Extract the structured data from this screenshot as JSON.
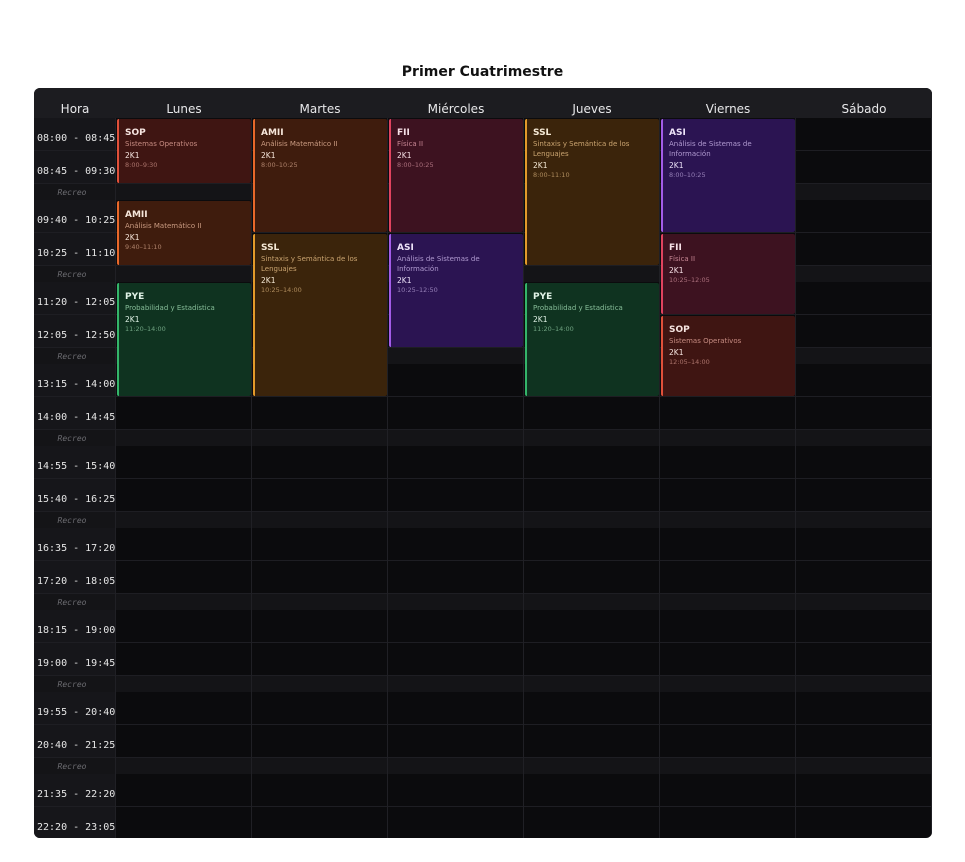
{
  "title": "Primer Cuatrimestre",
  "header": {
    "hora": "Hora",
    "days": [
      "Lunes",
      "Martes",
      "Miércoles",
      "Jueves",
      "Viernes",
      "Sábado"
    ]
  },
  "rows": [
    {
      "type": "slot",
      "label": "08:00 - 08:45"
    },
    {
      "type": "slot",
      "label": "08:45 - 09:30"
    },
    {
      "type": "recess",
      "label": "Recreo"
    },
    {
      "type": "slot",
      "label": "09:40 - 10:25"
    },
    {
      "type": "slot",
      "label": "10:25 - 11:10"
    },
    {
      "type": "recess",
      "label": "Recreo"
    },
    {
      "type": "slot",
      "label": "11:20 - 12:05"
    },
    {
      "type": "slot",
      "label": "12:05 - 12:50"
    },
    {
      "type": "recess",
      "label": "Recreo"
    },
    {
      "type": "slot",
      "label": "13:15 - 14:00"
    },
    {
      "type": "slot",
      "label": "14:00 - 14:45"
    },
    {
      "type": "recess",
      "label": "Recreo"
    },
    {
      "type": "slot",
      "label": "14:55 - 15:40"
    },
    {
      "type": "slot",
      "label": "15:40 - 16:25"
    },
    {
      "type": "recess",
      "label": "Recreo"
    },
    {
      "type": "slot",
      "label": "16:35 - 17:20"
    },
    {
      "type": "slot",
      "label": "17:20 - 18:05"
    },
    {
      "type": "recess",
      "label": "Recreo"
    },
    {
      "type": "slot",
      "label": "18:15 - 19:00"
    },
    {
      "type": "slot",
      "label": "19:00 - 19:45"
    },
    {
      "type": "recess",
      "label": "Recreo"
    },
    {
      "type": "slot",
      "label": "19:55 - 20:40"
    },
    {
      "type": "slot",
      "label": "20:40 - 21:25"
    },
    {
      "type": "recess",
      "label": "Recreo"
    },
    {
      "type": "slot",
      "label": "21:35 - 22:20"
    },
    {
      "type": "slot",
      "label": "22:20 - 23:05"
    }
  ],
  "classes": [
    {
      "code": "SOP",
      "name": "Sistemas Operativos",
      "group": "2K1",
      "time": "8:00–9:30",
      "day": 0,
      "start": "08:00",
      "end": "09:30",
      "color": "#e0503a",
      "theme": "sop"
    },
    {
      "code": "AMII",
      "name": "Análisis Matemático II",
      "group": "2K1",
      "time": "9:40–11:10",
      "day": 0,
      "start": "09:40",
      "end": "11:10",
      "color": "#e8682a",
      "theme": "amii"
    },
    {
      "code": "PYE",
      "name": "Probabilidad y Estadística",
      "group": "2K1",
      "time": "11:20–14:00",
      "day": 0,
      "start": "11:20",
      "end": "14:00",
      "color": "#34b56a",
      "theme": "pye"
    },
    {
      "code": "AMII",
      "name": "Análisis Matemático II",
      "group": "2K1",
      "time": "8:00–10:25",
      "day": 1,
      "start": "08:00",
      "end": "10:25",
      "color": "#e8682a",
      "theme": "amii"
    },
    {
      "code": "SSL",
      "name": "Sintaxis y Semántica de los Lenguajes",
      "group": "2K1",
      "time": "10:25–14:00",
      "day": 1,
      "start": "10:25",
      "end": "14:00",
      "color": "#e29a2a",
      "theme": "ssl"
    },
    {
      "code": "FII",
      "name": "Física II",
      "group": "2K1",
      "time": "8:00–10:25",
      "day": 2,
      "start": "08:00",
      "end": "10:25",
      "color": "#e0435f",
      "theme": "fii"
    },
    {
      "code": "ASI",
      "name": "Análisis de Sistemas de Información",
      "group": "2K1",
      "time": "10:25–12:50",
      "day": 2,
      "start": "10:25",
      "end": "12:50",
      "color": "#a35ce8",
      "theme": "asi"
    },
    {
      "code": "SSL",
      "name": "Sintaxis y Semántica de los Lenguajes",
      "group": "2K1",
      "time": "8:00–11:10",
      "day": 3,
      "start": "08:00",
      "end": "11:10",
      "color": "#e29a2a",
      "theme": "ssl"
    },
    {
      "code": "PYE",
      "name": "Probabilidad y Estadística",
      "group": "2K1",
      "time": "11:20–14:00",
      "day": 3,
      "start": "11:20",
      "end": "14:00",
      "color": "#34b56a",
      "theme": "pye"
    },
    {
      "code": "ASI",
      "name": "Análisis de Sistemas de Información",
      "group": "2K1",
      "time": "8:00–10:25",
      "day": 4,
      "start": "08:00",
      "end": "10:25",
      "color": "#a35ce8",
      "theme": "asi"
    },
    {
      "code": "FII",
      "name": "Física II",
      "group": "2K1",
      "time": "10:25–12:05",
      "day": 4,
      "start": "10:25",
      "end": "12:05",
      "color": "#e0435f",
      "theme": "fii"
    },
    {
      "code": "SOP",
      "name": "Sistemas Operativos",
      "group": "2K1",
      "time": "12:05–14:00",
      "day": 4,
      "start": "12:05",
      "end": "14:00",
      "color": "#e0503a",
      "theme": "sop"
    }
  ]
}
